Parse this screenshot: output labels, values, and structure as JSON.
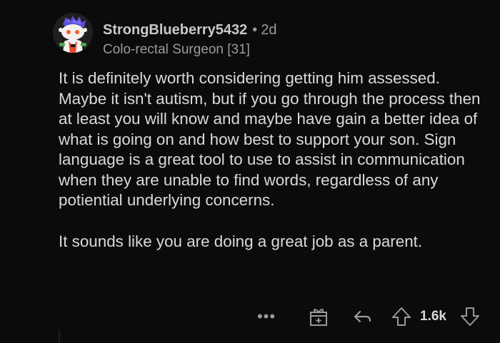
{
  "comment": {
    "username": "StrongBlueberry5432",
    "separator": "•",
    "age": "2d",
    "flair": "Colo-rectal Surgeon [31]",
    "paragraphs": [
      "It is definitely worth considering getting him assessed. Maybe it isn't autism, but if you go through the process then at least you will know and maybe have gain a better idea of what is going on and how best to support your son. Sign language is a great tool to use to assist in communication when they are unable to find words, regardless of any potiential underlying concerns.",
      "It sounds like you are doing a great job as a parent."
    ]
  },
  "actions": {
    "more_label": "•••",
    "score": "1.6k",
    "icons": {
      "more": "more-icon",
      "award": "award-icon",
      "reply": "reply-icon",
      "upvote": "upvote-icon",
      "downvote": "downvote-icon"
    }
  },
  "colors": {
    "background": "#0b0b0b",
    "text": "#d7dadc",
    "muted": "#9a9a9a"
  }
}
